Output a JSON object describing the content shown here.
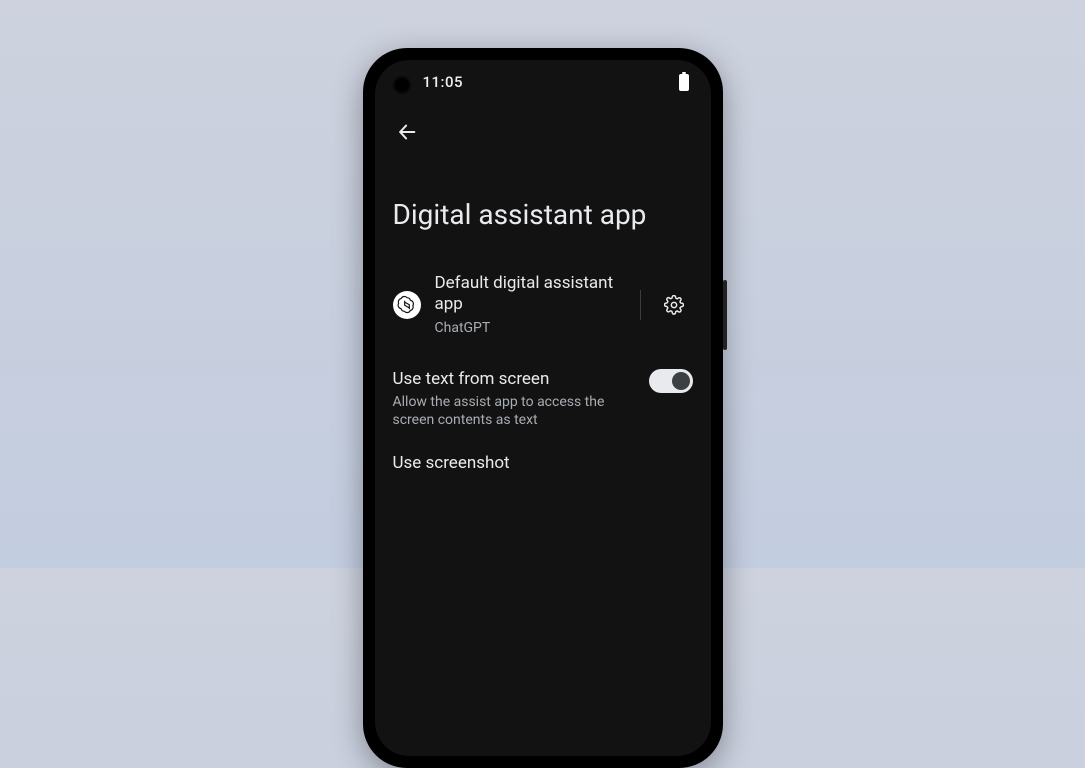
{
  "status": {
    "time": "11:05"
  },
  "page": {
    "title": "Digital assistant app"
  },
  "defaultApp": {
    "label": "Default digital assistant app",
    "value": "ChatGPT"
  },
  "textFromScreen": {
    "label": "Use text from screen",
    "description": "Allow the assist app to access the screen contents as text",
    "enabled": true
  },
  "screenshot": {
    "label": "Use screenshot"
  }
}
